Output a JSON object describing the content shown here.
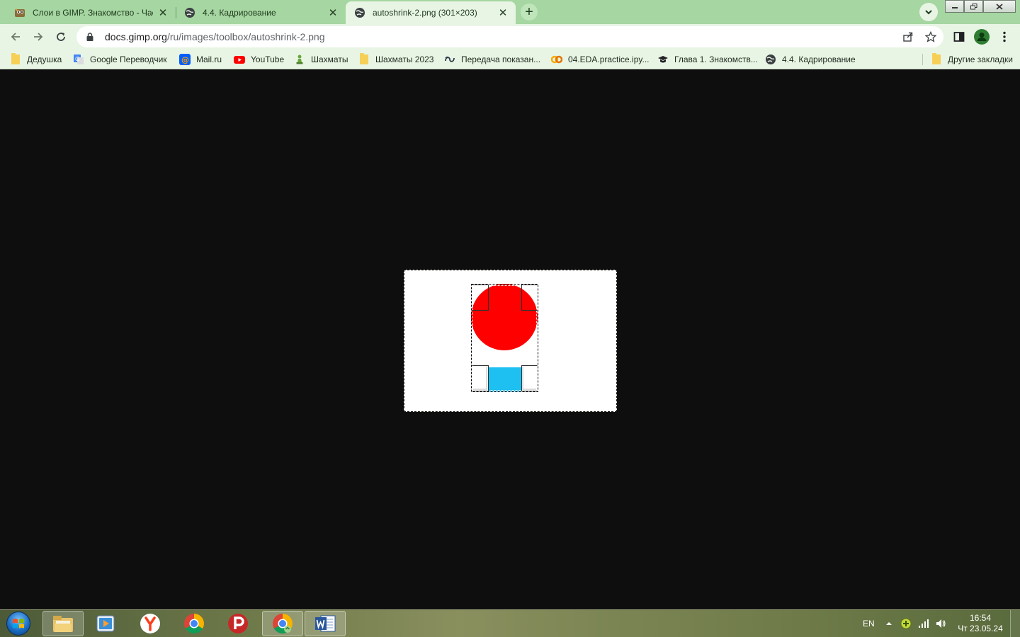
{
  "browser": {
    "tabs": [
      {
        "title": "Слои в GIMP. Знакомство - Част",
        "favicon": "gimp-wilber-icon",
        "active": false
      },
      {
        "title": "4.4. Кадрирование",
        "favicon": "globe-icon",
        "active": false
      },
      {
        "title": "autoshrink-2.png (301×203)",
        "favicon": "globe-icon",
        "active": true
      }
    ],
    "address_bar": {
      "domain": "docs.gimp.org",
      "path": "/ru/images/toolbox/autoshrink-2.png"
    },
    "bookmarks": [
      {
        "label": "Дедушка",
        "icon": "folder-icon"
      },
      {
        "label": "Google Переводчик",
        "icon": "google-translate-icon"
      },
      {
        "label": "Mail.ru",
        "icon": "mailru-icon"
      },
      {
        "label": "YouTube",
        "icon": "youtube-icon"
      },
      {
        "label": "Шахматы",
        "icon": "chess-pawn-icon"
      },
      {
        "label": "Шахматы 2023",
        "icon": "folder-icon"
      },
      {
        "label": "Передача показан...",
        "icon": "infinity-icon"
      },
      {
        "label": "04.EDA.practice.ipy...",
        "icon": "colab-icon"
      },
      {
        "label": "Глава 1. Знакомств...",
        "icon": "graduation-cap-icon"
      },
      {
        "label": "4.4. Кадрирование",
        "icon": "globe-icon"
      }
    ],
    "other_bookmarks": "Другие закладки"
  },
  "image": {
    "canvas_color": "#ffffff",
    "circle_color": "#ff0000",
    "rect_color": "#1ec0f2"
  },
  "taskbar": {
    "language": "EN",
    "time": "16:54",
    "date": "Чт 23.05.24",
    "apps": [
      "windows-explorer-icon",
      "media-player-icon",
      "yandex-browser-icon",
      "chrome-icon",
      "presentation-app-icon",
      "chrome-remote-icon",
      "word-icon"
    ]
  }
}
